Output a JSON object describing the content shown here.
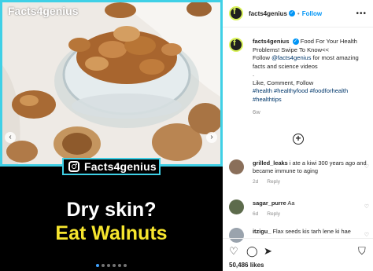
{
  "media": {
    "watermark": "Facts4genius",
    "brand_tag": "Facts4genius",
    "headline_line1": "Dry skin?",
    "headline_line2": "Eat Walnuts",
    "accent_color": "#3fd0e6",
    "highlight_color": "#f6e52e",
    "carousel_total": 6,
    "carousel_active_index": 0,
    "prev_icon": "chevron-left-icon",
    "next_icon": "chevron-right-icon"
  },
  "header": {
    "username": "facts4genius",
    "separator": "•",
    "follow_label": "Follow",
    "more_icon": "ellipsis-icon"
  },
  "caption": {
    "username": "facts4genius",
    "text1": "Food For Your Health Problems! Swipe To Know<<",
    "text2_prefix": "Follow ",
    "mention": "@facts4genius",
    "text2_suffix": " for most amazing facts and science videos",
    "bullet": ".",
    "cta": "Like, Comment, Follow",
    "hashtags": "#health #healthyfood #foodforhealth #healthtips",
    "age": "6w"
  },
  "comments": [
    {
      "user": "grilled_leaks",
      "text": "i ate a kiwi 300 years ago and became immune to aging",
      "age": "2d",
      "reply": "Reply"
    },
    {
      "user": "sagar_purre",
      "text": "Aa",
      "age": "6d",
      "reply": "Reply"
    },
    {
      "user": "itzigu_",
      "text": "Flax seeds kis tarh lene ki hae",
      "age": "",
      "reply": ""
    }
  ],
  "actions": {
    "like_icon": "heart-icon",
    "comment_icon": "comment-icon",
    "share_icon": "send-icon",
    "save_icon": "bookmark-icon"
  },
  "likes": "50,486 likes"
}
